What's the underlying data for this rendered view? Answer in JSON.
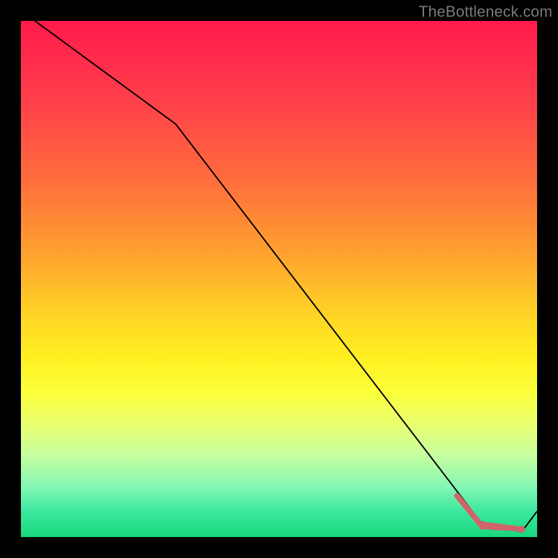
{
  "watermark": "TheBottleneck.com",
  "chart_data": {
    "type": "line",
    "title": "",
    "xlabel": "",
    "ylabel": "",
    "xlim": [
      0,
      100
    ],
    "ylim": [
      0,
      100
    ],
    "series": [
      {
        "name": "curve",
        "color": "#000000",
        "stroke_width": 2,
        "x": [
          0,
          30,
          89,
          97,
          100
        ],
        "y": [
          102,
          80,
          3,
          1,
          5
        ]
      },
      {
        "name": "highlight-segment",
        "color": "#d16468",
        "stroke_width": 8,
        "linecap": "round",
        "x": [
          84.5,
          89,
          97
        ],
        "y": [
          8,
          2.5,
          1.5
        ]
      }
    ],
    "markers": [
      {
        "name": "highlight-dot",
        "x": 97,
        "y": 1.5,
        "r": 5,
        "color": "#d16468"
      }
    ],
    "dashes": [
      {
        "x0": 89.2,
        "x1": 90.6,
        "y": 1.8
      },
      {
        "x0": 91.2,
        "x1": 92.0,
        "y": 1.7
      },
      {
        "x0": 92.6,
        "x1": 94.6,
        "y": 1.6
      },
      {
        "x0": 95.2,
        "x1": 96.0,
        "y": 1.55
      }
    ],
    "dash_style": {
      "color": "#d16468",
      "stroke_width": 5,
      "linecap": "round"
    }
  }
}
